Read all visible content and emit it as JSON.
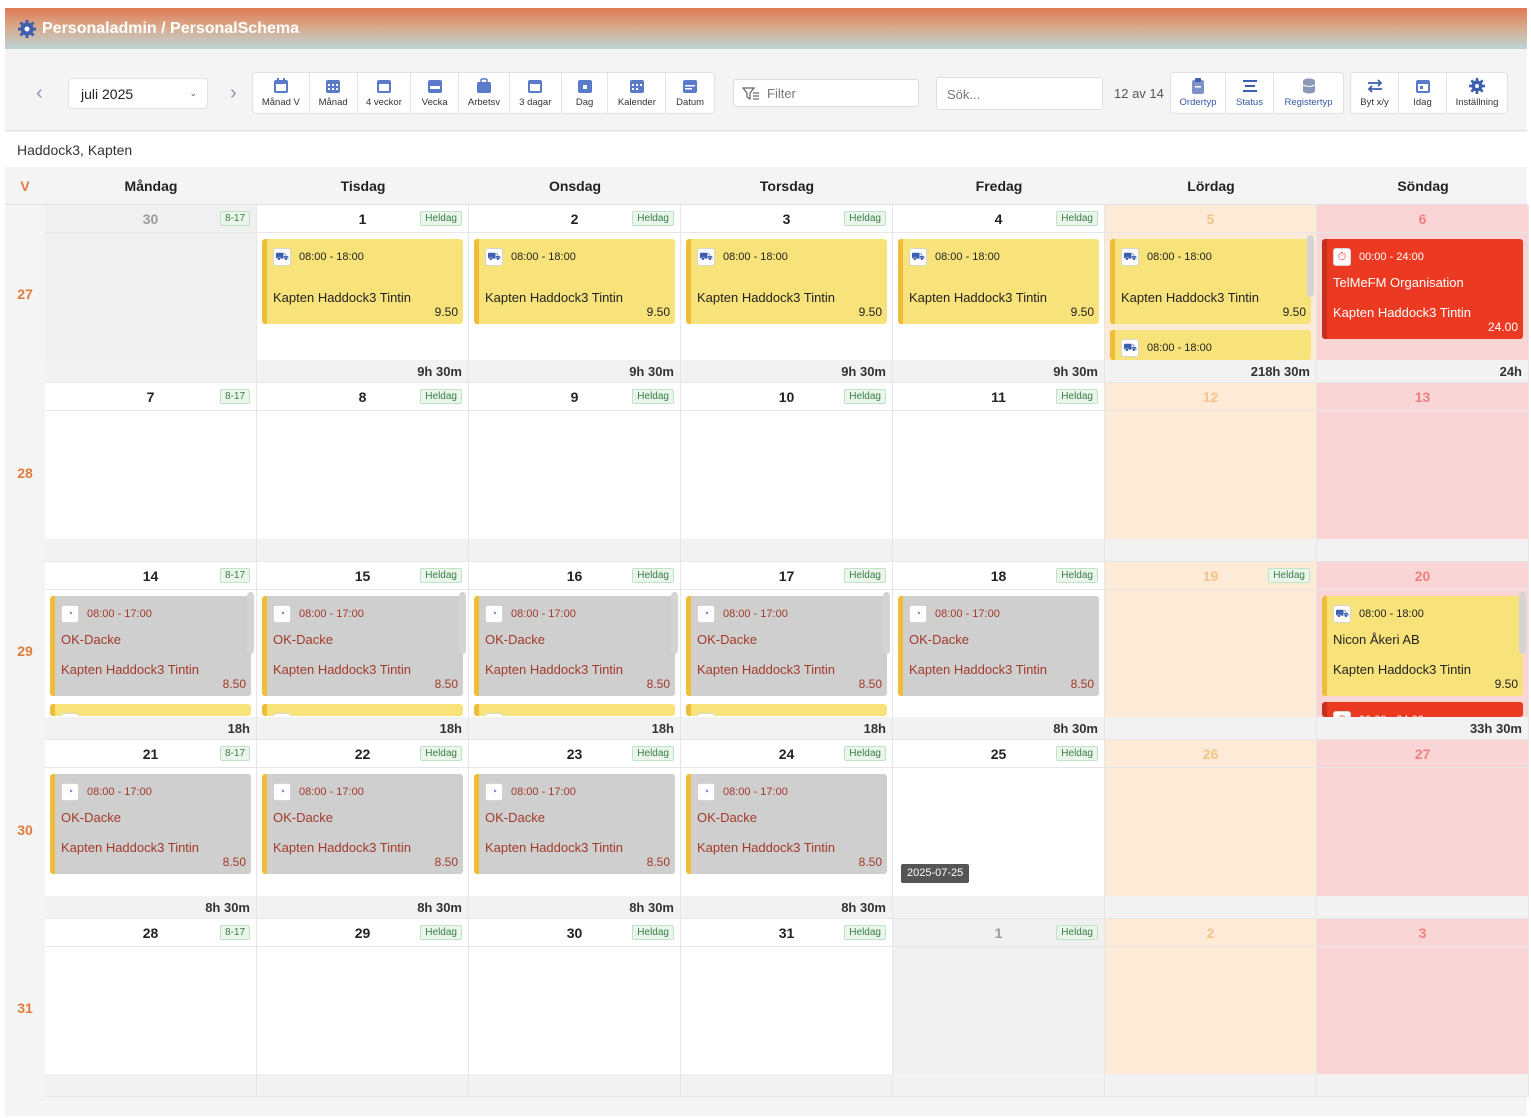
{
  "title": "Personaladmin / PersonalSchema",
  "month_select": "juli 2025",
  "views": [
    "Månad V",
    "Månad",
    "4 veckor",
    "Vecka",
    "Arbetsv",
    "3 dagar",
    "Dag",
    "Kalender",
    "Datum"
  ],
  "filter_placeholder": "Filter",
  "search_placeholder": "Sök...",
  "counter": "12 av 14",
  "right_buttons_1": [
    "Ordertyp",
    "Status",
    "Registertyp"
  ],
  "right_buttons_2": [
    "Byt x/y",
    "Idag",
    "Inställning"
  ],
  "person": "Haddock3, Kapten",
  "week_header": "V",
  "day_names": [
    "Måndag",
    "Tisdag",
    "Onsdag",
    "Torsdag",
    "Fredag",
    "Lördag",
    "Söndag"
  ],
  "weeks": [
    {
      "num": "27",
      "days": [
        {
          "d": "30",
          "badge": "8-17",
          "type": "grey",
          "total": ""
        },
        {
          "d": "1",
          "badge": "Heldag",
          "type": "normal",
          "total": "9h 30m"
        },
        {
          "d": "2",
          "badge": "Heldag",
          "type": "normal",
          "total": "9h 30m"
        },
        {
          "d": "3",
          "badge": "Heldag",
          "type": "normal",
          "total": "9h 30m"
        },
        {
          "d": "4",
          "badge": "Heldag",
          "type": "normal",
          "total": "9h 30m"
        },
        {
          "d": "5",
          "badge": "",
          "type": "sat",
          "total": "218h 30m"
        },
        {
          "d": "6",
          "badge": "",
          "type": "sun",
          "total": "24h"
        }
      ]
    },
    {
      "num": "28",
      "days": [
        {
          "d": "7",
          "badge": "8-17",
          "type": "normal",
          "total": ""
        },
        {
          "d": "8",
          "badge": "Heldag",
          "type": "normal",
          "total": ""
        },
        {
          "d": "9",
          "badge": "Heldag",
          "type": "normal",
          "total": ""
        },
        {
          "d": "10",
          "badge": "Heldag",
          "type": "normal",
          "total": ""
        },
        {
          "d": "11",
          "badge": "Heldag",
          "type": "normal",
          "total": ""
        },
        {
          "d": "12",
          "badge": "",
          "type": "sat",
          "total": ""
        },
        {
          "d": "13",
          "badge": "",
          "type": "sun",
          "total": ""
        }
      ]
    },
    {
      "num": "29",
      "days": [
        {
          "d": "14",
          "badge": "8-17",
          "type": "normal",
          "total": "18h"
        },
        {
          "d": "15",
          "badge": "Heldag",
          "type": "normal",
          "total": "18h"
        },
        {
          "d": "16",
          "badge": "Heldag",
          "type": "normal",
          "total": "18h"
        },
        {
          "d": "17",
          "badge": "Heldag",
          "type": "normal",
          "total": "18h"
        },
        {
          "d": "18",
          "badge": "Heldag",
          "type": "normal",
          "total": "8h 30m"
        },
        {
          "d": "19",
          "badge": "Heldag",
          "type": "sat",
          "total": ""
        },
        {
          "d": "20",
          "badge": "",
          "type": "sun",
          "total": "33h 30m"
        }
      ]
    },
    {
      "num": "30",
      "days": [
        {
          "d": "21",
          "badge": "8-17",
          "type": "normal",
          "total": "8h 30m"
        },
        {
          "d": "22",
          "badge": "Heldag",
          "type": "normal",
          "total": "8h 30m"
        },
        {
          "d": "23",
          "badge": "Heldag",
          "type": "normal",
          "total": "8h 30m"
        },
        {
          "d": "24",
          "badge": "Heldag",
          "type": "normal",
          "total": "8h 30m"
        },
        {
          "d": "25",
          "badge": "Heldag",
          "type": "normal",
          "total": ""
        },
        {
          "d": "26",
          "badge": "",
          "type": "sat",
          "total": ""
        },
        {
          "d": "27",
          "badge": "",
          "type": "sun",
          "total": ""
        }
      ]
    },
    {
      "num": "31",
      "days": [
        {
          "d": "28",
          "badge": "8-17",
          "type": "normal",
          "total": ""
        },
        {
          "d": "29",
          "badge": "Heldag",
          "type": "normal",
          "total": ""
        },
        {
          "d": "30",
          "badge": "Heldag",
          "type": "normal",
          "total": ""
        },
        {
          "d": "31",
          "badge": "Heldag",
          "type": "normal",
          "total": ""
        },
        {
          "d": "1",
          "badge": "Heldag",
          "type": "grey",
          "total": ""
        },
        {
          "d": "2",
          "badge": "",
          "type": "sat",
          "total": ""
        },
        {
          "d": "3",
          "badge": "",
          "type": "sun",
          "total": ""
        }
      ]
    }
  ],
  "events": {
    "yellow": {
      "time": "08:00 - 18:00",
      "who": "Kapten Haddock3 Tintin",
      "hrs": "9.50"
    },
    "red": {
      "time": "00:00 - 24:00",
      "org": "TelMeFM Organisation",
      "who": "Kapten Haddock3 Tintin",
      "hrs": "24.00"
    },
    "grey": {
      "time": "08:00 - 17:00",
      "org": "OK-Dacke",
      "who": "Kapten Haddock3 Tintin",
      "hrs": "8.50"
    },
    "nicon": {
      "time": "08:00 - 18:00",
      "org": "Nicon Åkeri AB",
      "who": "Kapten Haddock3 Tintin",
      "hrs": "9.50"
    }
  },
  "tooltip": "2025-07-25",
  "colors": {
    "accent": "#e07b3c",
    "event_yellow": "#f8e37a",
    "event_red": "#ec3a22",
    "event_grey": "#cfcfcf",
    "saturday": "#fdebd8",
    "sunday": "#f9d5d5"
  }
}
